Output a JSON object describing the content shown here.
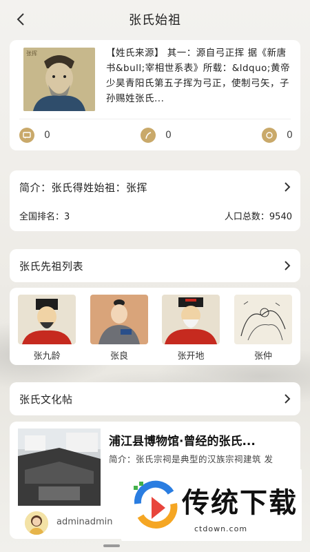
{
  "header": {
    "title": "张氏始祖"
  },
  "origin_card": {
    "portrait_label": "张挥",
    "text": "【姓氏来源】 其一：源自弓正挥 据《新唐书&bull;宰相世系表》所载：&ldquo;黄帝少昊青阳氏第五子挥为弓正，使制弓矢，子孙赐姓张氏...",
    "comments": "0",
    "likes": "0",
    "shares": "0"
  },
  "intro_card": {
    "summary": "简介：张氏得姓始祖：张挥",
    "rank": "全国排名：3",
    "population": "人口总数：9540"
  },
  "ancestors_section": {
    "title": "张氏先祖列表"
  },
  "ancestors": [
    {
      "name": "张九龄"
    },
    {
      "name": "张良"
    },
    {
      "name": "张开地"
    },
    {
      "name": "张仲"
    }
  ],
  "culture_section": {
    "title": "张氏文化帖"
  },
  "post": {
    "title": "浦江县博物馆·曾经的张氏...",
    "intro": "简介：张氏宗祠是典型的汉族宗祠建筑 发",
    "author": "adminadmin"
  },
  "watermark": {
    "brand": "传统下载",
    "domain": "ctdown.com"
  },
  "colors": {
    "accent": "#c9a96a",
    "card": "#ffffff"
  }
}
